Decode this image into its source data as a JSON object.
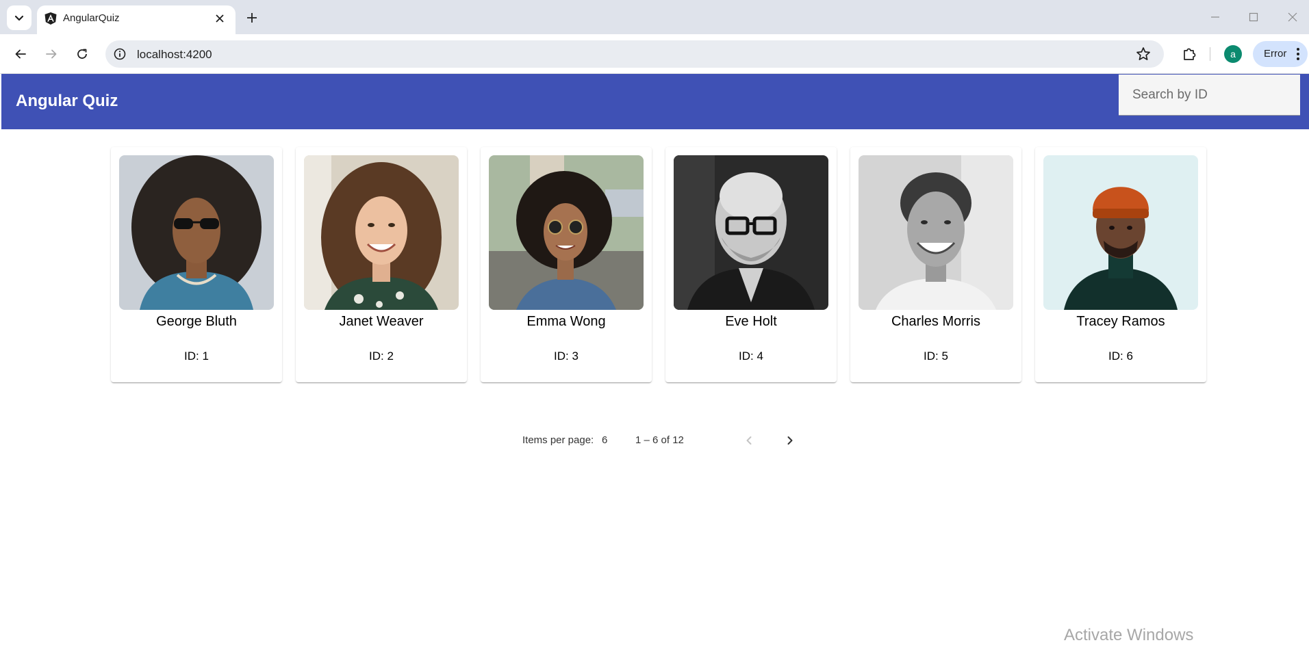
{
  "browser": {
    "tab": {
      "title": "AngularQuiz"
    },
    "url": "localhost:4200",
    "profile_initial": "a",
    "error_chip_label": "Error"
  },
  "app": {
    "title": "Angular Quiz",
    "search": {
      "placeholder": "Search by ID",
      "value": ""
    },
    "users": [
      {
        "name": "George Bluth",
        "id_label": "ID: 1"
      },
      {
        "name": "Janet Weaver",
        "id_label": "ID: 2"
      },
      {
        "name": "Emma Wong",
        "id_label": "ID: 3"
      },
      {
        "name": "Eve Holt",
        "id_label": "ID: 4"
      },
      {
        "name": "Charles Morris",
        "id_label": "ID: 5"
      },
      {
        "name": "Tracey Ramos",
        "id_label": "ID: 6"
      }
    ],
    "paginator": {
      "items_per_page_label": "Items per page:",
      "page_size": "6",
      "range_label": "1 – 6 of 12",
      "prev_enabled": false,
      "next_enabled": true
    }
  },
  "os": {
    "watermark": "Activate Windows"
  },
  "colors": {
    "header": "#3f51b5",
    "tab_strip": "#dfe3eb",
    "omnibox": "#e9ecf1",
    "error_chip": "#d3e3fd"
  }
}
